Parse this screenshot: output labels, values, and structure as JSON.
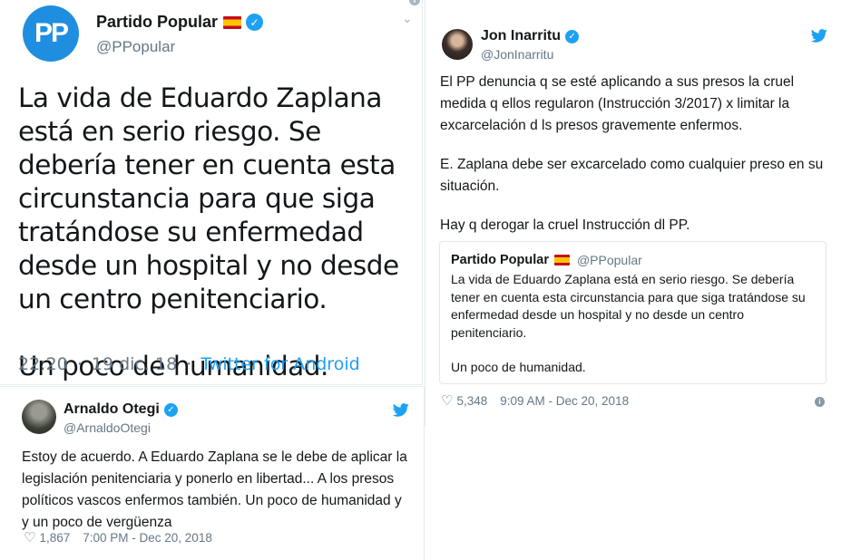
{
  "pp_tweet": {
    "logo_text": "PP",
    "display_name": "Partido Popular",
    "handle": "@PPopular",
    "paragraphs": [
      "La vida de Eduardo Zaplana está en serio riesgo. Se debería tener en cuenta esta circunstancia para que siga tratándose su enfermedad desde un hospital y no desde un centro penitenciario.",
      "Un poco de humanidad."
    ],
    "time": "22:20",
    "date": "19 dic. 18",
    "separator": "·",
    "source": "Twitter for Android"
  },
  "otegi_tweet": {
    "display_name": "Arnaldo Otegi",
    "handle": "@ArnaldoOtegi",
    "text": "Estoy de acuerdo. A Eduardo Zaplana se le debe de aplicar la legislación penitenciaria y ponerlo en libertad... A los presos políticos vascos enfermos también. Un poco de humanidad y y un poco de vergüenza",
    "likes": "1,867",
    "timestamp": "7:00 PM - Dec 20, 2018"
  },
  "jon_tweet": {
    "display_name": "Jon Inarritu",
    "handle": "@JonInarritu",
    "paragraphs": [
      "El PP denuncia q se esté aplicando a sus presos la cruel medida q ellos regularon (Instrucción 3/2017) x limitar la excarcelación d ls presos gravemente enfermos.",
      "E. Zaplana debe ser excarcelado como cualquier preso en su situación.",
      "Hay q derogar la cruel Instrucción dl PP."
    ],
    "quoted": {
      "display_name": "Partido Popular",
      "handle": "@PPopular",
      "paragraphs": [
        "La vida de Eduardo Zaplana está en serio riesgo. Se debería tener en cuenta esta circunstancia para que siga tratándose su enfermedad desde un hospital y no desde un centro penitenciario.",
        "Un poco de humanidad."
      ]
    },
    "likes": "5,348",
    "timestamp": "9:09 AM - Dec 20, 2018"
  },
  "icons": {
    "verified": "✓",
    "heart": "♡",
    "info": "i",
    "chevron": "⌄"
  },
  "colors": {
    "twitter_blue": "#1da1f2",
    "pp_blue": "#1f8ee0",
    "text": "#14171a",
    "muted": "#657786"
  }
}
